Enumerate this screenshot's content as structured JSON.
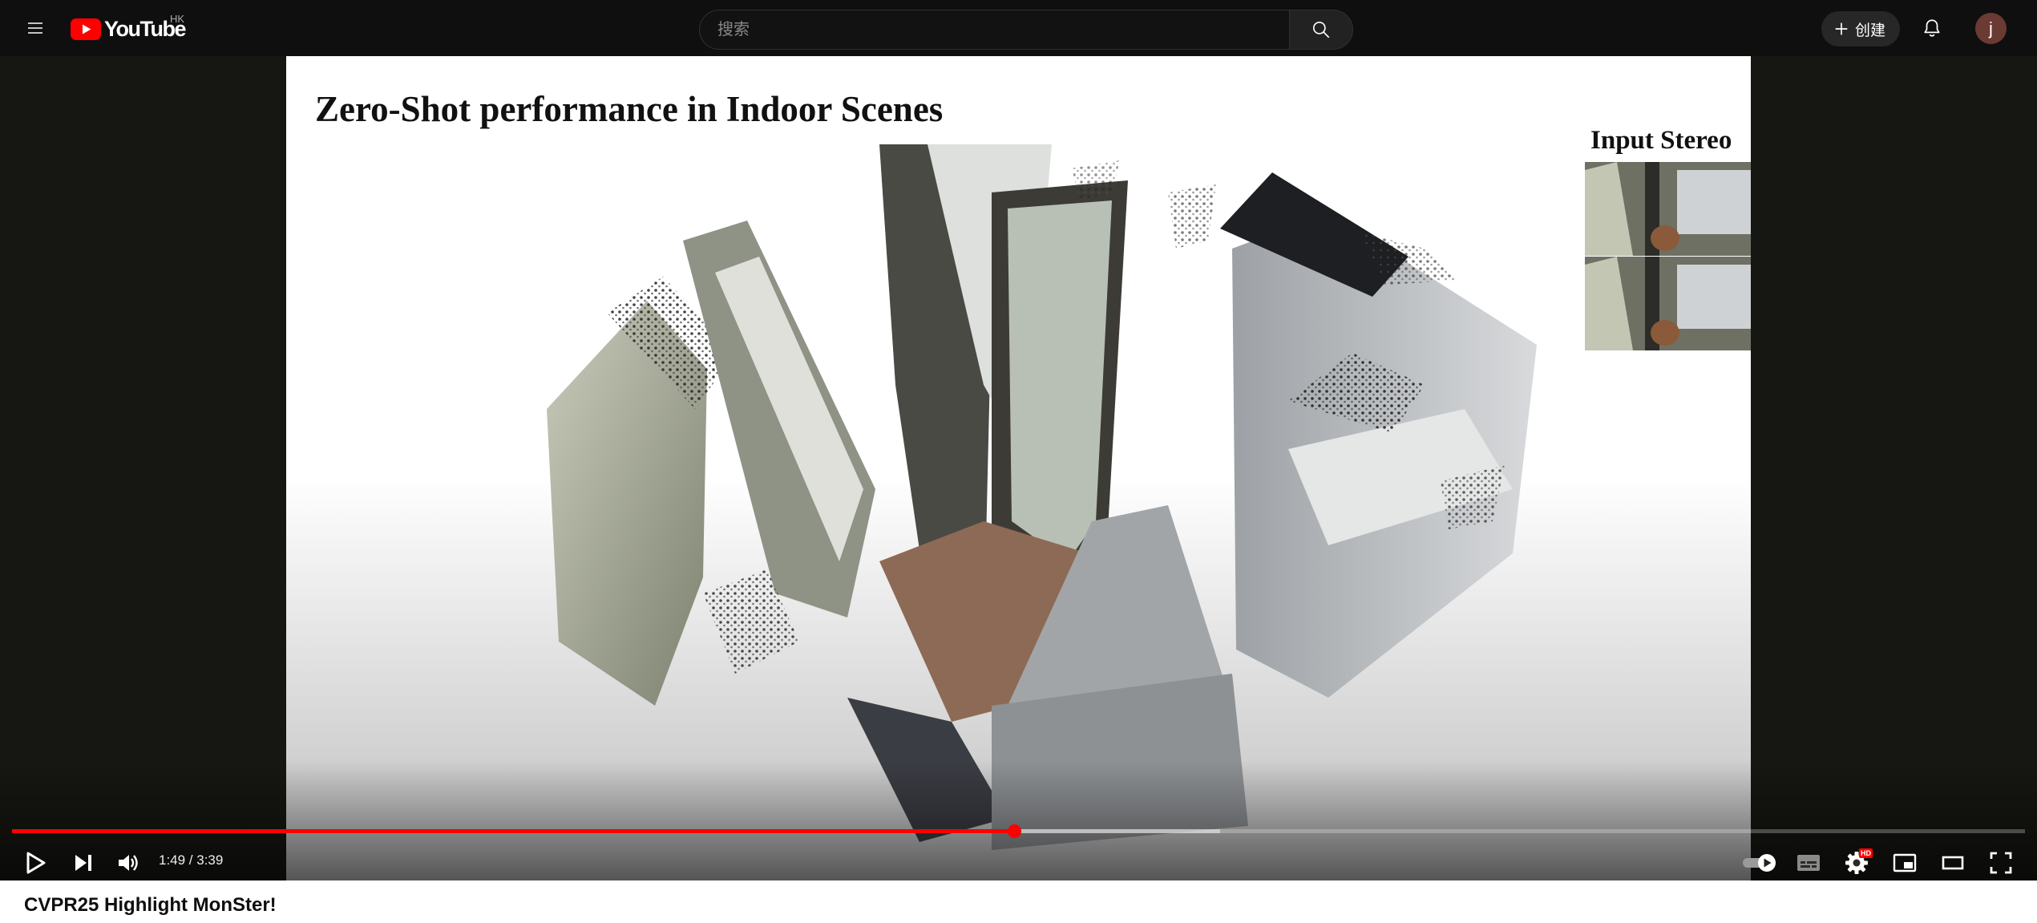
{
  "masthead": {
    "logo_text": "YouTube",
    "region": "HK",
    "search_placeholder": "搜索",
    "create_label": "创建",
    "avatar_initial": "j"
  },
  "player": {
    "slide_title": "Zero-Shot performance in Indoor Scenes",
    "stereo_label": "Input Stereo",
    "current_time": "1:49",
    "duration": "3:39",
    "time_text": "1:49 / 3:39",
    "progress_fraction": 0.4977,
    "buffered_fraction": 0.6,
    "settings_badge": "HD"
  },
  "video": {
    "title": "CVPR25 Highlight MonSter!"
  },
  "colors": {
    "brand_red": "#ff0000",
    "masthead_bg": "#0f0f0f",
    "player_bg": "#161612"
  }
}
